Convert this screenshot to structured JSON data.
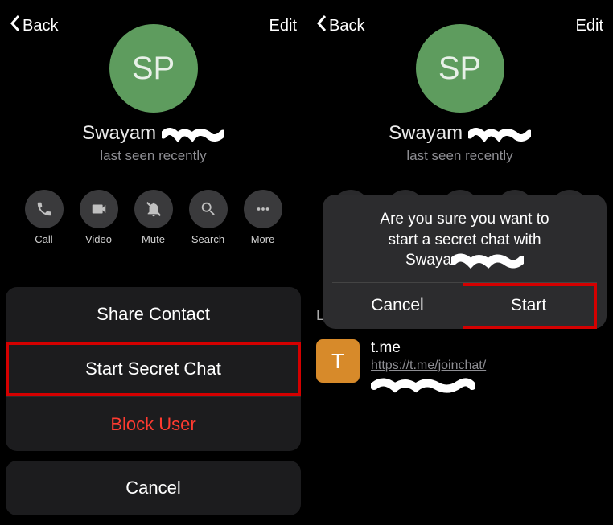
{
  "header": {
    "back": "Back",
    "edit": "Edit"
  },
  "profile": {
    "initials": "SP",
    "name": "Swayam",
    "status": "last seen recently"
  },
  "actions": {
    "call": "Call",
    "video": "Video",
    "mute": "Mute",
    "search": "Search",
    "more": "More"
  },
  "sheet": {
    "share": "Share Contact",
    "secret": "Start Secret Chat",
    "block": "Block User",
    "cancel": "Cancel"
  },
  "dialog": {
    "line1": "Are you sure you want to",
    "line2": "start a secret chat with",
    "name_prefix": "Swaya",
    "cancel": "Cancel",
    "start": "Start"
  },
  "rightContent": {
    "tabLetter": "Li",
    "linkThumb": "T",
    "linkTitle": "t.me",
    "linkUrl": "https://t.me/joinchat/"
  },
  "colors": {
    "highlight": "#d40000",
    "avatar": "#5e9c5e",
    "destructive": "#ff3b30"
  }
}
